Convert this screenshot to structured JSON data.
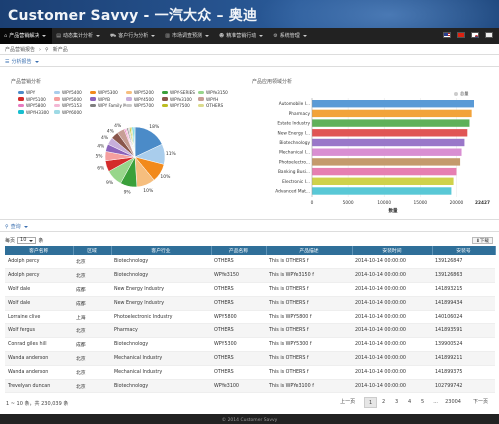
{
  "app": {
    "title": "Customer Savvy - 一汽大众 – 奥迪"
  },
  "nav": {
    "items": [
      {
        "label": "产品营销解决",
        "icon": "home-icon"
      },
      {
        "label": "动态集计分析",
        "icon": "bars-icon"
      },
      {
        "label": "客户行为分析",
        "icon": "cart-icon"
      },
      {
        "label": "市场调查预测",
        "icon": "chart-icon"
      },
      {
        "label": "精准营销行动",
        "icon": "user-icon"
      },
      {
        "label": "系统管理",
        "icon": "gear-icon"
      }
    ]
  },
  "breadcrumb": {
    "root": "产品营销报告",
    "current": "新产品"
  },
  "analysis": {
    "section_label": "分析报告",
    "left_title": "产品营销分析",
    "right_title": "产品应用领域分析"
  },
  "chart_data": [
    {
      "type": "pie",
      "legend": [
        "WPY",
        "WPY5400",
        "WPY5300",
        "WPY5200",
        "WPY-SERIES",
        "WPYe3150",
        "WPY5100",
        "WPY5000",
        "WPYB",
        "WPY4500",
        "WPYe3100",
        "WPYH",
        "WPY5800",
        "WPY5153",
        "WPY Family M...",
        "WPY5700",
        "WPY7500",
        "OTHERS",
        "WPYH3300",
        "WPY6000"
      ],
      "slice_labels": [
        "18%",
        "11%",
        "10%",
        "10%",
        "9%",
        "9%",
        "6%",
        "5%",
        "4%",
        "4%",
        "4%",
        "4%"
      ],
      "colors": [
        "#4b8bc8",
        "#a9cdec",
        "#f28a1c",
        "#f6be7e",
        "#3aa03a",
        "#97d68b",
        "#d42b2b",
        "#f59f9f",
        "#8c63bb",
        "#c7aedb",
        "#8a564c",
        "#c79e95",
        "#e77bc0",
        "#f3b7d4",
        "#7f7f7f",
        "#c7c7c7",
        "#bcbd22",
        "#dbdb8d",
        "#17becf",
        "#9edae5"
      ]
    },
    {
      "type": "bar",
      "orientation": "horizontal",
      "series_name": "总量",
      "xlabel": "数量",
      "categories": [
        "Automobile I...",
        "Pharmacy",
        "Estate Industry",
        "New Energy I...",
        "Biotechnology",
        "Mechanical I...",
        "Photoelectro...",
        "Banking Busi...",
        "Electronic I...",
        "Advanced Mat..."
      ],
      "values": [
        22427,
        22100,
        21800,
        21500,
        21100,
        20700,
        20500,
        20000,
        19600,
        19300
      ],
      "xticks": [
        "0",
        "5000",
        "10000",
        "15000",
        "20000"
      ],
      "max_label": "22427",
      "xlim": [
        0,
        22427
      ],
      "colors": [
        "#5a9ad6",
        "#f2a33a",
        "#5fb15a",
        "#e05555",
        "#9a77c9",
        "#d98fd2",
        "#c49a6c",
        "#e67fb1",
        "#cfd24b",
        "#59c8d6"
      ]
    }
  ],
  "query": {
    "label": "查询"
  },
  "table_controls": {
    "prefix": "每页",
    "page_size": "10",
    "suffix": "条",
    "export_label": "下载"
  },
  "table": {
    "headers": [
      "客户名称",
      "区域",
      "客户行业",
      "产品名称",
      "产品描述",
      "安装时间",
      "安装号"
    ],
    "rows": [
      [
        "Adolph percy",
        "北京",
        "Biotechnology",
        "OTHERS",
        "This is OTHERS f",
        "2014-10-14 00:00:00",
        "139126847"
      ],
      [
        "Adolph percy",
        "北京",
        "Biotechnology",
        "WPYe3150",
        "This is WPYe3150 f",
        "2014-10-14 00:00:00",
        "139126863"
      ],
      [
        "Wolf dale",
        "成都",
        "New Energy Industry",
        "OTHERS",
        "This is OTHERS f",
        "2014-10-14 00:00:00",
        "141893215"
      ],
      [
        "Wolf dale",
        "成都",
        "New Energy Industry",
        "OTHERS",
        "This is OTHERS f",
        "2014-10-14 00:00:00",
        "141899434"
      ],
      [
        "Lorraine clive",
        "上海",
        "Photoelectronic Industry",
        "WPY5800",
        "This is WPY5800 f",
        "2014-10-14 00:00:00",
        "140106024"
      ],
      [
        "Wolf fergus",
        "北京",
        "Pharmacy",
        "OTHERS",
        "This is OTHERS f",
        "2014-10-14 00:00:00",
        "141893591"
      ],
      [
        "Conrad giles hill",
        "成都",
        "Biotechnology",
        "WPY5300",
        "This is WPY5300 f",
        "2014-10-14 00:00:00",
        "139900524"
      ],
      [
        "Wanda anderson",
        "北京",
        "Mechanical Industry",
        "OTHERS",
        "This is OTHERS f",
        "2014-10-14 00:00:00",
        "141899211"
      ],
      [
        "Wanda anderson",
        "北京",
        "Mechanical Industry",
        "OTHERS",
        "This is OTHERS f",
        "2014-10-14 00:00:00",
        "141899375"
      ],
      [
        "Trevelyan duncan",
        "北京",
        "Biotechnology",
        "WPYe3100",
        "This is WPYe3100 f",
        "2014-10-14 00:00:00",
        "102799742"
      ]
    ]
  },
  "pagination": {
    "info": "1 ~ 10 条，共 230,039 条",
    "prev": "上一页",
    "pages": [
      "1",
      "2",
      "3",
      "4",
      "5",
      "...",
      "23004"
    ],
    "next": "下一页",
    "current": "1"
  },
  "footer": {
    "text": "© 2014 Customer Savvy"
  }
}
